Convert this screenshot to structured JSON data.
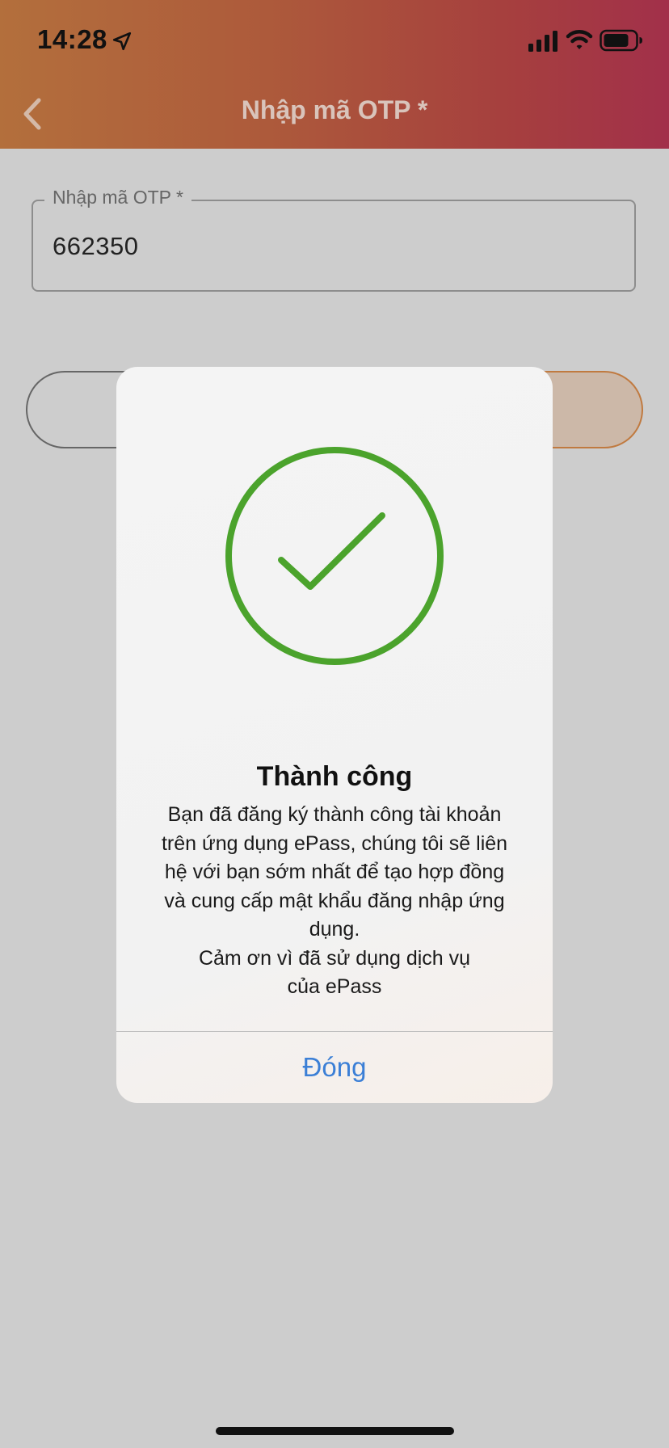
{
  "status_bar": {
    "time": "14:28"
  },
  "nav": {
    "title": "Nhập mã OTP *"
  },
  "otp_field": {
    "label": "Nhập mã OTP *",
    "value": "662350"
  },
  "dialog": {
    "title": "Thành công",
    "message": "Bạn đã đăng ký thành công tài khoản\ntrên ứng dụng ePass, chúng tôi sẽ liên\nhệ với bạn sớm nhất để tạo hợp đồng\nvà cung cấp mật khẩu đăng nhập ứng\ndụng.\nCảm ơn vì đã sử dụng dịch vụ\ncủa ePass",
    "close_label": "Đóng"
  },
  "icons": {
    "back": "chevron-left-icon",
    "location": "location-arrow-icon",
    "signal": "cellular-signal-icon",
    "wifi": "wifi-icon",
    "battery": "battery-icon",
    "success": "checkmark-circle-icon"
  },
  "colors": {
    "header_gradient_start": "#b36f3c",
    "header_gradient_end": "#a2304a",
    "success_green": "#4ba32c",
    "link_blue": "#3b7fd6"
  }
}
